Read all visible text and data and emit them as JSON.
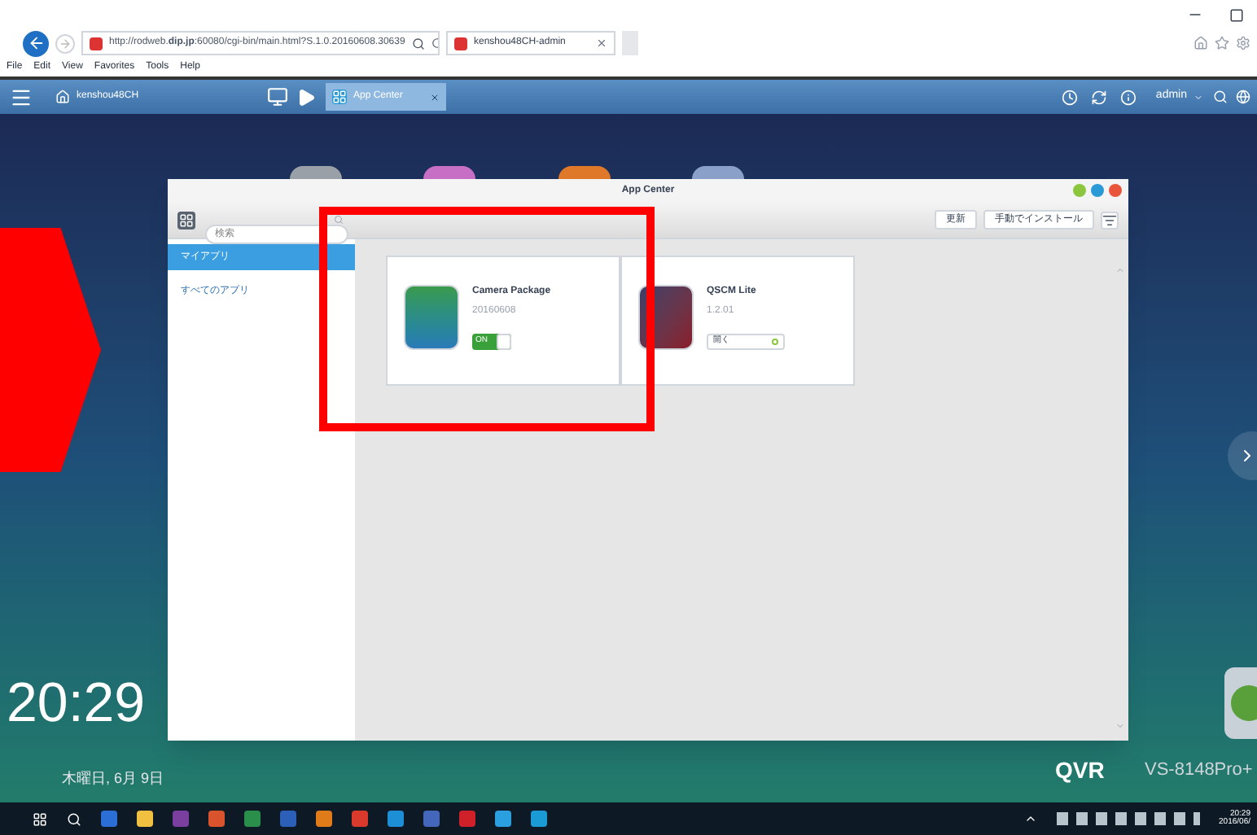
{
  "browser": {
    "address": "http://rodweb.**dip.jp**:60080/cgi-bin/main.html?S.1.0.20160608.30639",
    "tab": "kenshou48CH-admin",
    "menu": [
      "File",
      "Edit",
      "View",
      "Favorites",
      "Tools",
      "Help"
    ]
  },
  "topbar": {
    "host": "kenshou48CH",
    "task_tab": "App Center",
    "user": "admin"
  },
  "window": {
    "title": "App Center",
    "search": {
      "placeholder": "検索"
    },
    "buttons": [
      "更新",
      "手動でインストール"
    ],
    "sidebar": [
      {
        "label": "マイアプリ",
        "selected": true
      },
      {
        "label": "すべてのアプリ",
        "selected": false
      }
    ],
    "apps": [
      {
        "name": "Camera Package",
        "version": "20160608",
        "kind": "toggle",
        "on": true,
        "control": "ON"
      },
      {
        "name": "QSCM Lite",
        "version": "1.2.01",
        "kind": "open",
        "control": "開く"
      }
    ]
  },
  "desktop": {
    "time": "20:29",
    "date": "木曜日, 6月 9日",
    "brand": "QVR",
    "model": "VS-8148Pro+"
  },
  "taskbar": {
    "time": "20:29",
    "date": "2016/06/"
  }
}
